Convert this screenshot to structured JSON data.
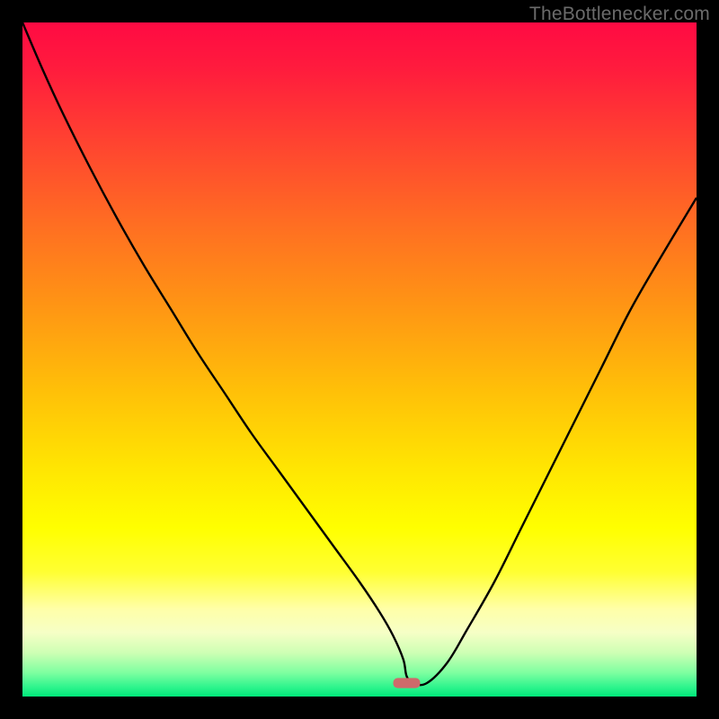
{
  "attribution": "TheBottlenecker.com",
  "chart_data": {
    "type": "line",
    "title": "",
    "xlabel": "",
    "ylabel": "",
    "xlim": [
      0,
      100
    ],
    "ylim": [
      0,
      100
    ],
    "series": [
      {
        "name": "bottleneck-curve",
        "x": [
          0,
          3,
          6,
          10,
          14,
          18,
          22,
          26,
          30,
          34,
          38,
          42,
          46,
          50,
          53,
          55,
          56.5,
          57,
          58,
          60,
          63,
          66,
          70,
          74,
          78,
          82,
          86,
          90,
          94,
          100
        ],
        "y": [
          100,
          93,
          86.5,
          78.5,
          71,
          64,
          57.5,
          51,
          45,
          39,
          33.5,
          28,
          22.5,
          17,
          12.5,
          9,
          5.5,
          3,
          2,
          2,
          5,
          10,
          17,
          25,
          33,
          41,
          49,
          57,
          64,
          74
        ]
      }
    ],
    "marker": {
      "x": 57,
      "y": 2,
      "width": 4,
      "height": 1.5,
      "color": "#CE6A6B"
    },
    "gradient_stops": [
      {
        "offset": 0,
        "color": "#FF0A43"
      },
      {
        "offset": 0.07,
        "color": "#FF1C3D"
      },
      {
        "offset": 0.18,
        "color": "#FF4430"
      },
      {
        "offset": 0.3,
        "color": "#FF6E22"
      },
      {
        "offset": 0.42,
        "color": "#FF9514"
      },
      {
        "offset": 0.55,
        "color": "#FFC108"
      },
      {
        "offset": 0.66,
        "color": "#FFE502"
      },
      {
        "offset": 0.75,
        "color": "#FFFF00"
      },
      {
        "offset": 0.815,
        "color": "#FFFF32"
      },
      {
        "offset": 0.87,
        "color": "#FFFFA8"
      },
      {
        "offset": 0.905,
        "color": "#F6FFC6"
      },
      {
        "offset": 0.935,
        "color": "#CEFFB4"
      },
      {
        "offset": 0.965,
        "color": "#7DFFA0"
      },
      {
        "offset": 0.985,
        "color": "#32F58E"
      },
      {
        "offset": 1.0,
        "color": "#00E87A"
      }
    ]
  }
}
